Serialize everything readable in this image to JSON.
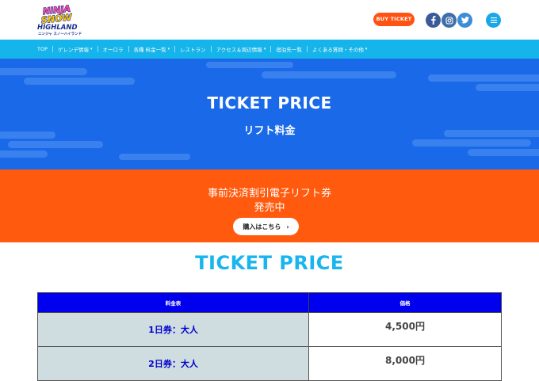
{
  "header": {
    "logo_text": [
      "NINJA",
      "SNOW",
      "HIGHLAND",
      "ニンジャ スノーハイランド"
    ],
    "buy_ticket_label": "BUY TICKET",
    "social_icons": [
      "facebook-icon",
      "instagram-icon",
      "twitter-icon"
    ],
    "menu_icon": "menu-icon"
  },
  "nav": {
    "items": [
      {
        "label": "TOP",
        "dropdown": false
      },
      {
        "label": "ゲレンデ情報",
        "dropdown": true
      },
      {
        "label": "オーロラ",
        "dropdown": false
      },
      {
        "label": "各種 料金一覧",
        "dropdown": true
      },
      {
        "label": "レストラン",
        "dropdown": false
      },
      {
        "label": "アクセス＆周辺情報",
        "dropdown": true
      },
      {
        "label": "宿泊先一覧",
        "dropdown": false
      },
      {
        "label": "よくある質問・その他",
        "dropdown": true
      }
    ]
  },
  "hero": {
    "title": "TICKET PRICE",
    "subtitle": "リフト料金"
  },
  "promo": {
    "line1": "事前決済割引電子リフト券",
    "line2": "発売中",
    "button_label": "購入はこちら",
    "button_chevron": "›"
  },
  "section": {
    "title": "TICKET PRICE"
  },
  "table": {
    "headers": [
      "料金表",
      "価格"
    ],
    "rows": [
      {
        "label": "1日券：大人",
        "price": "4,500円"
      },
      {
        "label": "2日券：大人",
        "price": "8,000円"
      }
    ]
  },
  "colors": {
    "nav": "#15b4ea",
    "hero": "#1a69e8",
    "promo": "#ff5a0d",
    "buy_button": "#ff5312",
    "table_header": "#0000ee",
    "table_label_cell": "#d0dde0"
  }
}
